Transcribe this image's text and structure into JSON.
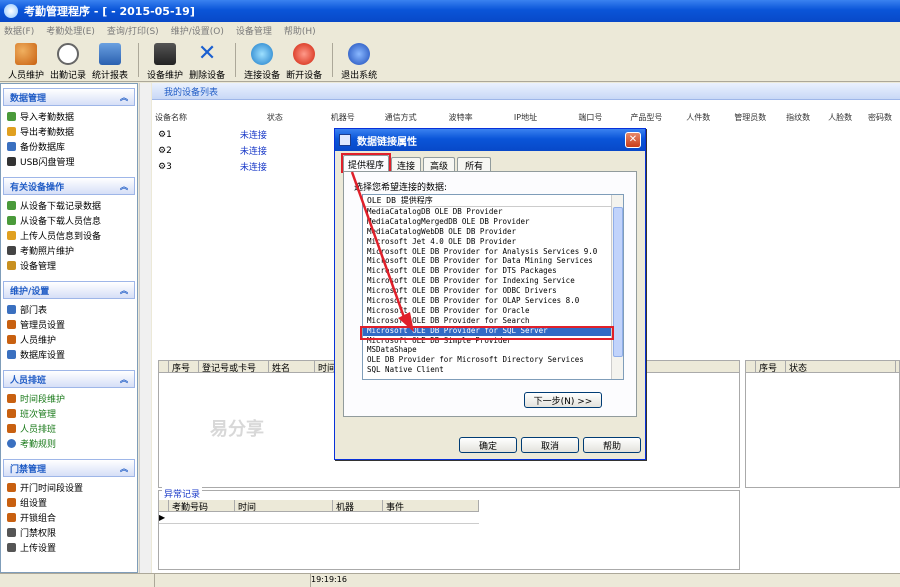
{
  "window": {
    "title": "考勤管理程序 - [ - 2015-05-19]"
  },
  "menu": [
    "数据(F)",
    "考勤处理(E)",
    "查询/打印(S)",
    "维护/设置(O)",
    "设备管理",
    "帮助(H)"
  ],
  "toolbar": {
    "people": "人员维护",
    "records": "出勤记录",
    "report": "统计报表",
    "device": "设备维护",
    "delete": "删除设备",
    "connect": "连接设备",
    "disconnect": "断开设备",
    "exit": "退出系统"
  },
  "sidebar": {
    "group1": "数据管理",
    "g1items": [
      "导入考勤数据",
      "导出考勤数据",
      "备份数据库",
      "USB闪盘管理"
    ],
    "group2": "有关设备操作",
    "g2items": [
      "从设备下载记录数据",
      "从设备下载人员信息",
      "上传人员信息到设备",
      "考勤照片维护",
      "设备管理"
    ],
    "group3": "维护/设置",
    "g3items": [
      "部门表",
      "管理员设置",
      "人员维护",
      "数据库设置"
    ],
    "group4": "人员排班",
    "g4items": [
      "时间段维护",
      "班次管理",
      "人员排班",
      "考勤规则"
    ],
    "group5": "门禁管理",
    "g5items": [
      "开门时间段设置",
      "组设置",
      "开锁组合",
      "门禁权限",
      "上传设置"
    ]
  },
  "main": {
    "header": "我的设备列表",
    "columns": [
      "设备名称",
      "状态",
      "机器号",
      "通信方式",
      "波特率",
      "IP地址",
      "端口号",
      "产品型号",
      "人件数",
      "管理员数",
      "指纹数",
      "人脸数",
      "密码数"
    ],
    "devices": [
      {
        "name": "1",
        "status": "未连接"
      },
      {
        "name": "2",
        "status": "未连接"
      },
      {
        "name": "3",
        "status": "未连接"
      }
    ],
    "lower_left_cols": [
      "序号",
      "登记号或卡号",
      "姓名",
      "时间"
    ],
    "lower_right_cols": [
      "序号",
      "状态"
    ],
    "abnormal_title": "异常记录",
    "abnormal_cols": [
      "考勤号码",
      "时间",
      "机器",
      "事件"
    ],
    "watermark": "易分享"
  },
  "status": {
    "time": "19:19:16"
  },
  "dialog": {
    "title": "数据链接属性",
    "tabs": [
      "提供程序",
      "连接",
      "高级",
      "所有"
    ],
    "prompt": "选择您希望连接的数据:",
    "list_header": "OLE DB 提供程序",
    "providers": [
      "MediaCatalogDB OLE DB Provider",
      "MediaCatalogMergedDB OLE DB Provider",
      "MediaCatalogWebDB OLE DB Provider",
      "Microsoft Jet 4.0 OLE DB Provider",
      "Microsoft OLE DB Provider for Analysis Services 9.0",
      "Microsoft OLE DB Provider for Data Mining Services",
      "Microsoft OLE DB Provider for DTS Packages",
      "Microsoft OLE DB Provider for Indexing Service",
      "Microsoft OLE DB Provider for ODBC Drivers",
      "Microsoft OLE DB Provider for OLAP Services 8.0",
      "Microsoft OLE DB Provider for Oracle",
      "Microsoft OLE DB Provider for Search",
      "Microsoft OLE DB Provider for SQL Server",
      "Microsoft OLE DB Simple Provider",
      "MSDataShape",
      "OLE DB Provider for Microsoft Directory Services",
      "SQL Native Client"
    ],
    "selected_index": 12,
    "next_button": "下一步(N) >>",
    "ok": "确定",
    "cancel": "取消",
    "help": "帮助"
  }
}
